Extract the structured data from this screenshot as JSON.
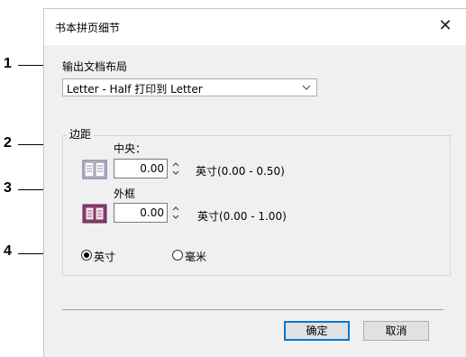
{
  "dialog": {
    "title": "书本拼页细节",
    "close_glyph": "✕"
  },
  "output_layout": {
    "label": "输出文档布局",
    "value": "Letter - Half 打印到 Letter"
  },
  "margins": {
    "group_label": "边距",
    "center": {
      "label": "中央：",
      "value": "0.00",
      "range": "英寸(0.00 - 0.50)"
    },
    "outer": {
      "label": "外框",
      "value": "0.00",
      "range": "英寸(0.00 - 1.00)"
    },
    "units": [
      {
        "label": "英寸",
        "checked": true
      },
      {
        "label": "毫米",
        "checked": false
      }
    ]
  },
  "buttons": {
    "ok": "确定",
    "cancel": "取消"
  },
  "callouts": [
    "1",
    "2",
    "3",
    "4"
  ]
}
